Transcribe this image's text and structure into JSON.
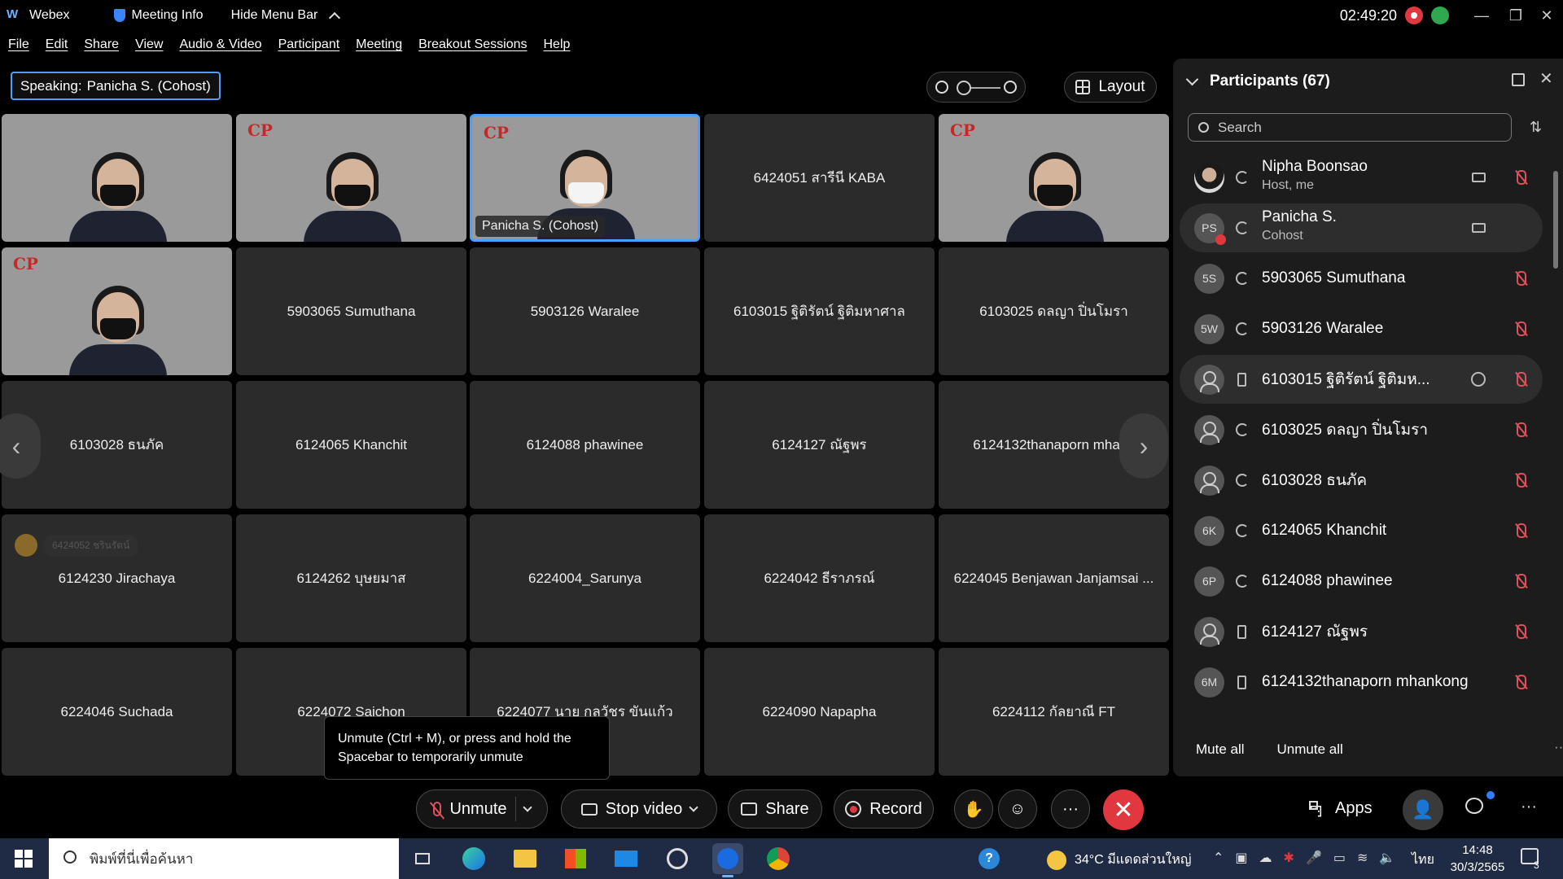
{
  "titlebar": {
    "app_name": "Webex",
    "meeting_info": "Meeting Info",
    "hide_menu": "Hide Menu Bar",
    "clock": "02:49:20"
  },
  "menu": [
    "File",
    "Edit",
    "Share",
    "View",
    "Audio & Video",
    "Participant",
    "Meeting",
    "Breakout Sessions",
    "Help"
  ],
  "speaking": {
    "prefix": "Speaking:",
    "name": "Panicha S. (Cohost)"
  },
  "layout_label": "Layout",
  "tiles": [
    {
      "name": "",
      "video": true,
      "mask": "black"
    },
    {
      "name": "",
      "video": true,
      "mask": "black",
      "logo": true
    },
    {
      "name": "Panicha S. (Cohost)",
      "video": true,
      "mask": "white",
      "logo": true,
      "active": true
    },
    {
      "name": "6424051 สารีนี KABA",
      "video": false
    },
    {
      "name": "",
      "video": true,
      "mask": "black",
      "logo": true
    },
    {
      "name": "",
      "video": true,
      "mask": "black",
      "logo": true
    },
    {
      "name": "5903065 Sumuthana",
      "video": false
    },
    {
      "name": "5903126 Waralee",
      "video": false
    },
    {
      "name": "6103015 ฐิติรัตน์ ฐิติมหาศาล",
      "video": false
    },
    {
      "name": "6103025 ดลญา ปิ่นโมรา",
      "video": false
    },
    {
      "name": "6103028 ธนภัค",
      "video": false
    },
    {
      "name": "6124065 Khanchit",
      "video": false
    },
    {
      "name": "6124088 phawinee",
      "video": false
    },
    {
      "name": "6124127 ณัฐพร",
      "video": false
    },
    {
      "name": "6124132thanaporn mhank",
      "video": false
    },
    {
      "name": "6124230 Jirachaya",
      "video": false,
      "raise": "6424052 ชรินรัตน์"
    },
    {
      "name": "6124262 บุษยมาส",
      "video": false
    },
    {
      "name": "6224004_Sarunya",
      "video": false
    },
    {
      "name": "6224042 ธีราภรณ์",
      "video": false
    },
    {
      "name": "6224045 Benjawan Janjamsai ...",
      "video": false
    },
    {
      "name": "6224046 Suchada",
      "video": false
    },
    {
      "name": "6224072 Saichon",
      "video": false
    },
    {
      "name": "6224077 นาย กลวัชร ขันแก้ว",
      "video": false
    },
    {
      "name": "6224090 Napapha",
      "video": false
    },
    {
      "name": "6224112 กัลยาณี FT",
      "video": false
    }
  ],
  "tooltip": "Unmute (Ctrl + M), or press and hold the Spacebar to temporarily unmute",
  "panel": {
    "title": "Participants (67)",
    "search_placeholder": "Search",
    "participants": [
      {
        "name": "Nipha Boonsao",
        "sub": "Host, me",
        "avatar": "photo",
        "conn": "sync",
        "cam": true
      },
      {
        "name": "Panicha S.",
        "sub": "Cohost",
        "avatar": "PS",
        "conn": "sync",
        "cam": true,
        "hl": true,
        "badge": true,
        "nomic": true
      },
      {
        "name": "5903065 Sumuthana",
        "avatar": "5S",
        "conn": "sync"
      },
      {
        "name": "5903126 Waralee",
        "avatar": "5W",
        "conn": "sync"
      },
      {
        "name": "6103015 ฐิติรัตน์ ฐิติมห...",
        "avatar": "generic",
        "conn": "phone",
        "chat": true,
        "hl": true
      },
      {
        "name": "6103025 ดลญา ปิ่นโมรา",
        "avatar": "generic",
        "conn": "sync"
      },
      {
        "name": "6103028 ธนภัค",
        "avatar": "generic",
        "conn": "sync"
      },
      {
        "name": "6124065 Khanchit",
        "avatar": "6K",
        "conn": "sync"
      },
      {
        "name": "6124088 phawinee",
        "avatar": "6P",
        "conn": "sync"
      },
      {
        "name": "6124127 ณัฐพร",
        "avatar": "generic",
        "conn": "phone"
      },
      {
        "name": "6124132thanaporn mhankong",
        "avatar": "6M",
        "conn": "phone"
      }
    ],
    "mute_all": "Mute all",
    "unmute_all": "Unmute all"
  },
  "controls": {
    "unmute": "Unmute",
    "stop_video": "Stop video",
    "share": "Share",
    "record": "Record",
    "apps": "Apps"
  },
  "taskbar": {
    "search_placeholder": "พิมพ์ที่นี่เพื่อค้นหา",
    "weather": "34°C  มีแดดส่วนใหญ่",
    "lang": "ไทย",
    "time": "14:48",
    "date": "30/3/2565",
    "notif_count": "3"
  },
  "colors": {
    "accent": "#4b9fff",
    "danger": "#e0383e",
    "panel_bg": "#1c1c1c",
    "tile_bg": "#2b2b2b"
  }
}
